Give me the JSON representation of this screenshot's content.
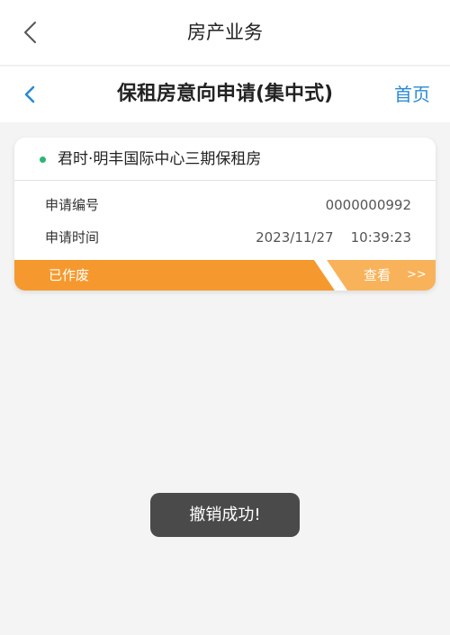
{
  "top_bar": {
    "title": "房产业务"
  },
  "sub_header": {
    "title": "保租房意向申请(集中式)",
    "home_label": "首页"
  },
  "card": {
    "project_name": "君时·明丰国际中心三期保租房",
    "fields": [
      {
        "label": "申请编号",
        "value": "0000000992"
      },
      {
        "label": "申请时间",
        "value": "2023/11/27    10:39:23"
      }
    ],
    "status": "已作废",
    "view_label": "查看",
    "view_arrow": ">>",
    "colors": {
      "status_bar": "#f5992e",
      "view_bar": "#f8b25a",
      "dot": "#2bb673"
    }
  },
  "toast": {
    "message": "撤销成功!"
  },
  "colors": {
    "accent": "#2a8ad4",
    "background": "#f4f4f4"
  }
}
